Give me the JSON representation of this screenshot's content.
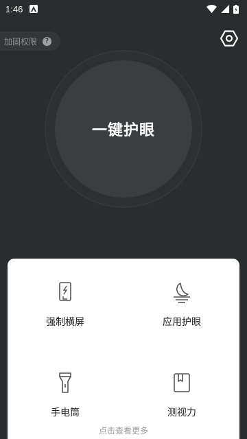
{
  "status_bar": {
    "time": "1:46",
    "icons": [
      "notification-app-icon",
      "wifi-icon",
      "signal-icon",
      "battery-icon"
    ]
  },
  "reinforce": {
    "label": "加固权限",
    "help_icon": "?"
  },
  "header": {
    "settings_icon": "settings-icon"
  },
  "main": {
    "button_label": "一键护眼"
  },
  "features": [
    {
      "label": "强制横屏",
      "icon": "rotate-phone-icon"
    },
    {
      "label": "应用护眼",
      "icon": "moon-icon"
    },
    {
      "label": "手电筒",
      "icon": "flashlight-icon"
    },
    {
      "label": "测视力",
      "icon": "book-icon"
    }
  ],
  "more_label": "点击查看更多",
  "colors": {
    "background": "#2a2d2e",
    "circle": "#3a3e40",
    "card": "#ffffff",
    "icon_stroke": "#555555"
  }
}
